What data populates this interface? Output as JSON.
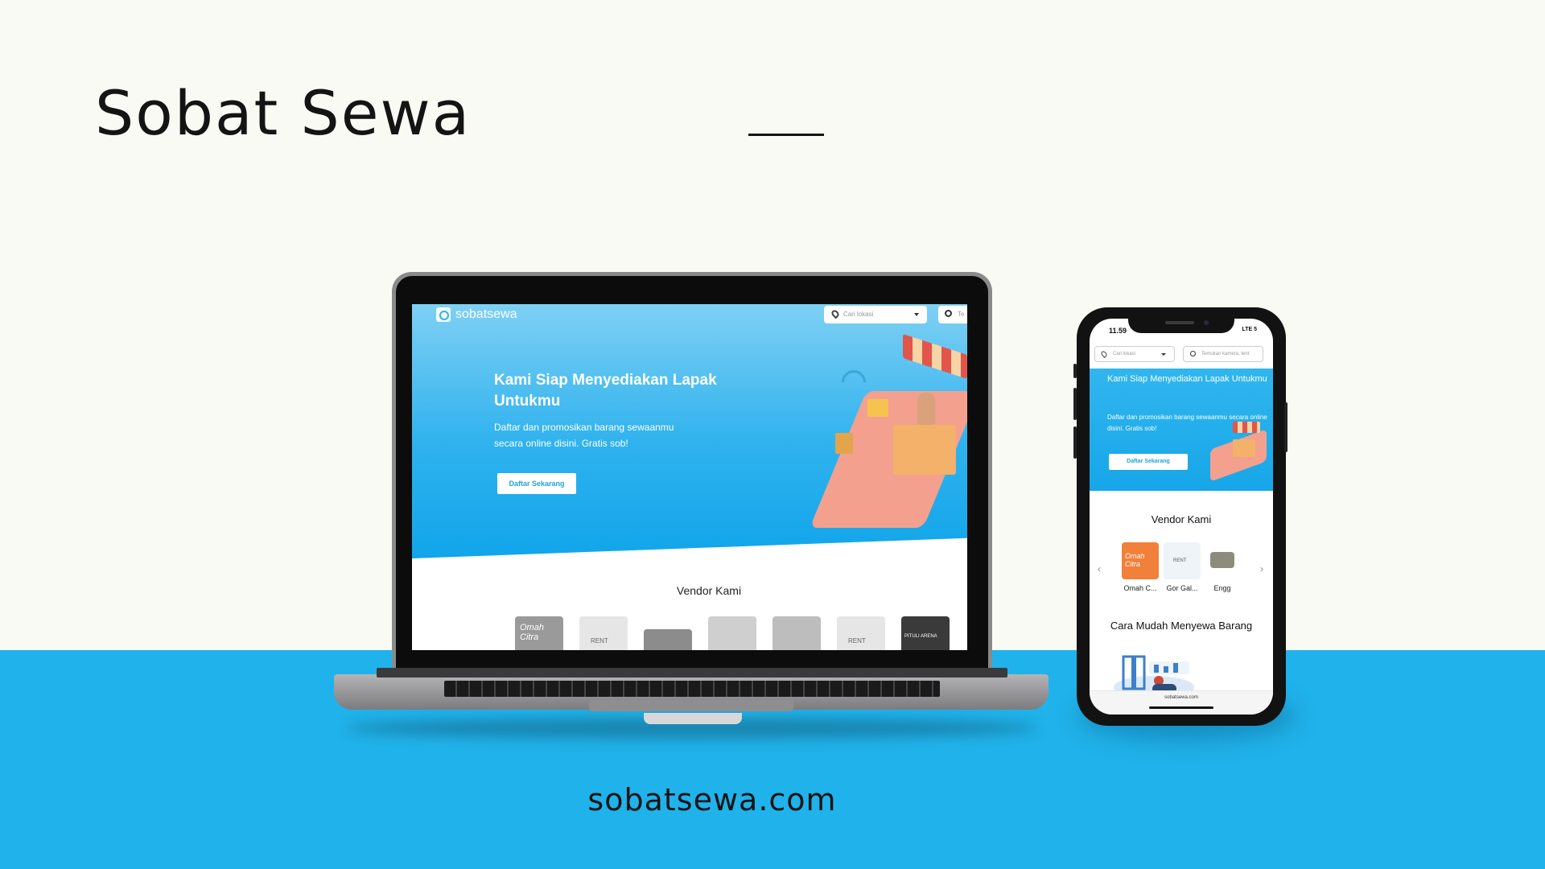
{
  "headline": "Sobat Sewa",
  "domain_caption": "sobatsewa.com",
  "colors": {
    "brand_blue": "#20b2ea",
    "hero_gradient_top": "#7fd0f4",
    "hero_gradient_bottom": "#11a5ea",
    "cta_text": "#1fa3dc",
    "background": "#fafaf4"
  },
  "laptop": {
    "logo_text": "sobatsewa",
    "location_placeholder": "Cari lokasi",
    "search_placeholder": "Te",
    "hero_title": "Kami Siap Menyediakan Lapak Untukmu",
    "hero_subtitle": "Daftar dan promosikan barang sewaanmu secara online disini. Gratis sob!",
    "cta_label": "Daftar Sekarang",
    "vendor_section_title": "Vendor Kami",
    "vendor_thumbs": [
      "Omah Citra",
      "RENT",
      "vendor-3",
      "vendor-4",
      "vendor-5",
      "RENT",
      "PITULI ARENA"
    ]
  },
  "phone": {
    "status_time": "11.59",
    "status_right": "LTE 5",
    "location_placeholder": "Cari lokasi",
    "search_placeholder": "Temukan kamera, tent",
    "hero_title": "Kami Siap Menyediakan Lapak Untukmu",
    "hero_subtitle": "Daftar dan promosikan barang sewaanmu secara online disini. Gratis sob!",
    "cta_label": "Daftar Sekarang",
    "vendor_section_title": "Vendor Kami",
    "vendors": [
      {
        "name": "Omah C...",
        "thumb_text": "Omah Citra"
      },
      {
        "name": "Gor Gal...",
        "thumb_text": "RENT"
      },
      {
        "name": "Engg",
        "thumb_text": ""
      }
    ],
    "prev_icon": "‹",
    "next_icon": "›",
    "howto_title": "Cara Mudah Menyewa Barang",
    "url": "sobatsewa.com"
  }
}
